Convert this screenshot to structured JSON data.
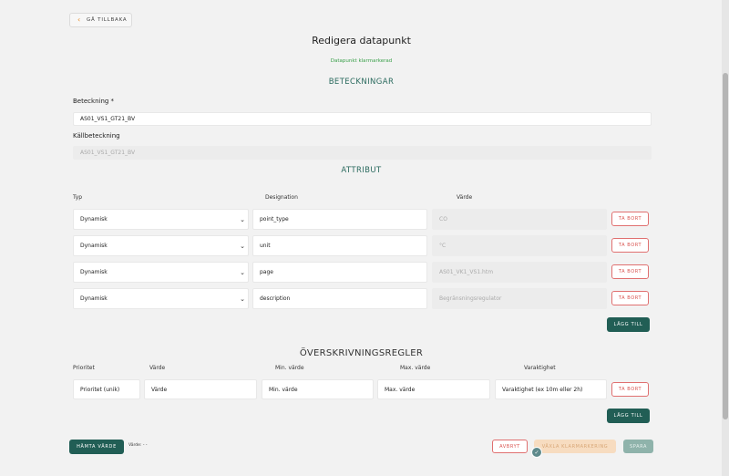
{
  "back_label": "GÅ TILLBAKA",
  "title": "Redigera datapunkt",
  "status_message": "Datapunkt klarmarkerad",
  "designations": {
    "title": "BETECKNINGAR",
    "designation_label": "Beteckning *",
    "designation_value": "AS01_VS1_GT21_BV",
    "source_label": "Källbeteckning",
    "source_value": "AS01_VS1_GT21_BV"
  },
  "attributes": {
    "title": "ATTRIBUT",
    "col_type": "Typ",
    "col_designation": "Designation",
    "col_value": "Värde",
    "rows": [
      {
        "type": "Dynamisk",
        "designation": "point_type",
        "value": "CO",
        "remove": "TA BORT"
      },
      {
        "type": "Dynamisk",
        "designation": "unit",
        "value": "°C",
        "remove": "TA BORT"
      },
      {
        "type": "Dynamisk",
        "designation": "page",
        "value": "AS01_VK1_VS1.htm",
        "remove": "TA BORT"
      },
      {
        "type": "Dynamisk",
        "designation": "description",
        "value": "Begränsningsregulator",
        "remove": "TA BORT"
      }
    ],
    "add_label": "LÄGG TILL"
  },
  "overrides": {
    "title": "ÖVERSKRIVNINGSREGLER",
    "col_priority": "Prioritet",
    "col_value": "Värde",
    "col_min": "Min. värde",
    "col_max": "Max. värde",
    "col_duration": "Varaktighet",
    "placeholders": {
      "priority": "Prioritet (unik)",
      "value": "Värde",
      "min": "Min. värde",
      "max": "Max. värde",
      "duration": "Varaktighet (ex 10m eller 2h)"
    },
    "remove": "TA BORT",
    "add_label": "LÄGG TILL"
  },
  "footer": {
    "fetch_label": "HÄMTA VÄRDE",
    "value_text": "Värde: - -",
    "cancel_label": "AVBRYT",
    "toggle_label": "VÄXLA KLARMARKERING",
    "save_label": "SPARA"
  },
  "colors": {
    "accent": "#215e55",
    "success": "#3aa04a",
    "danger": "#d9534f",
    "warning_light": "#f7dcc0"
  }
}
